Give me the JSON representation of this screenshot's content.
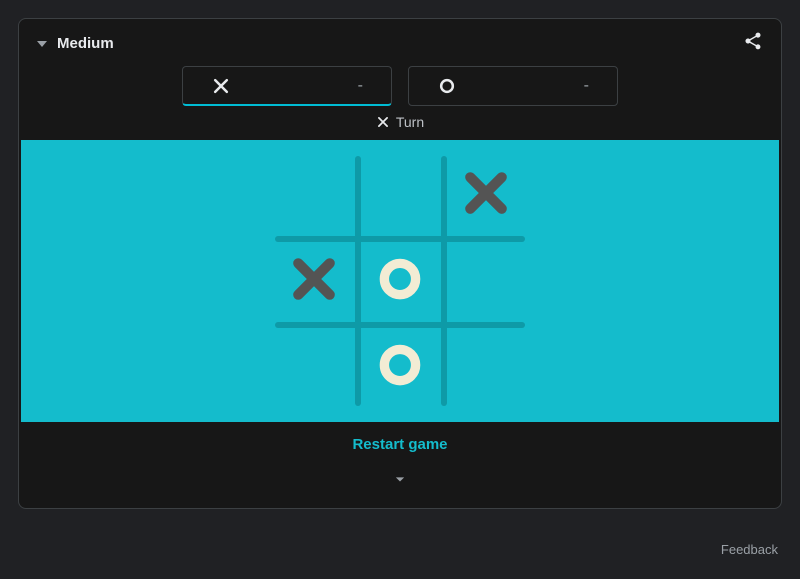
{
  "difficulty": {
    "label": "Medium"
  },
  "scores": {
    "x": {
      "value": "-",
      "active": true
    },
    "o": {
      "value": "-",
      "active": false
    }
  },
  "turn": {
    "symbol": "X",
    "label": "Turn"
  },
  "board": {
    "cells": [
      "",
      "",
      "X",
      "X",
      "O",
      "",
      "",
      "O",
      ""
    ]
  },
  "restart": {
    "label": "Restart game"
  },
  "feedback": {
    "label": "Feedback"
  },
  "colors": {
    "board_bg": "#14bccc",
    "x_mark": "#545454",
    "o_mark": "#f2ecd4",
    "accent": "#00bcd4"
  }
}
